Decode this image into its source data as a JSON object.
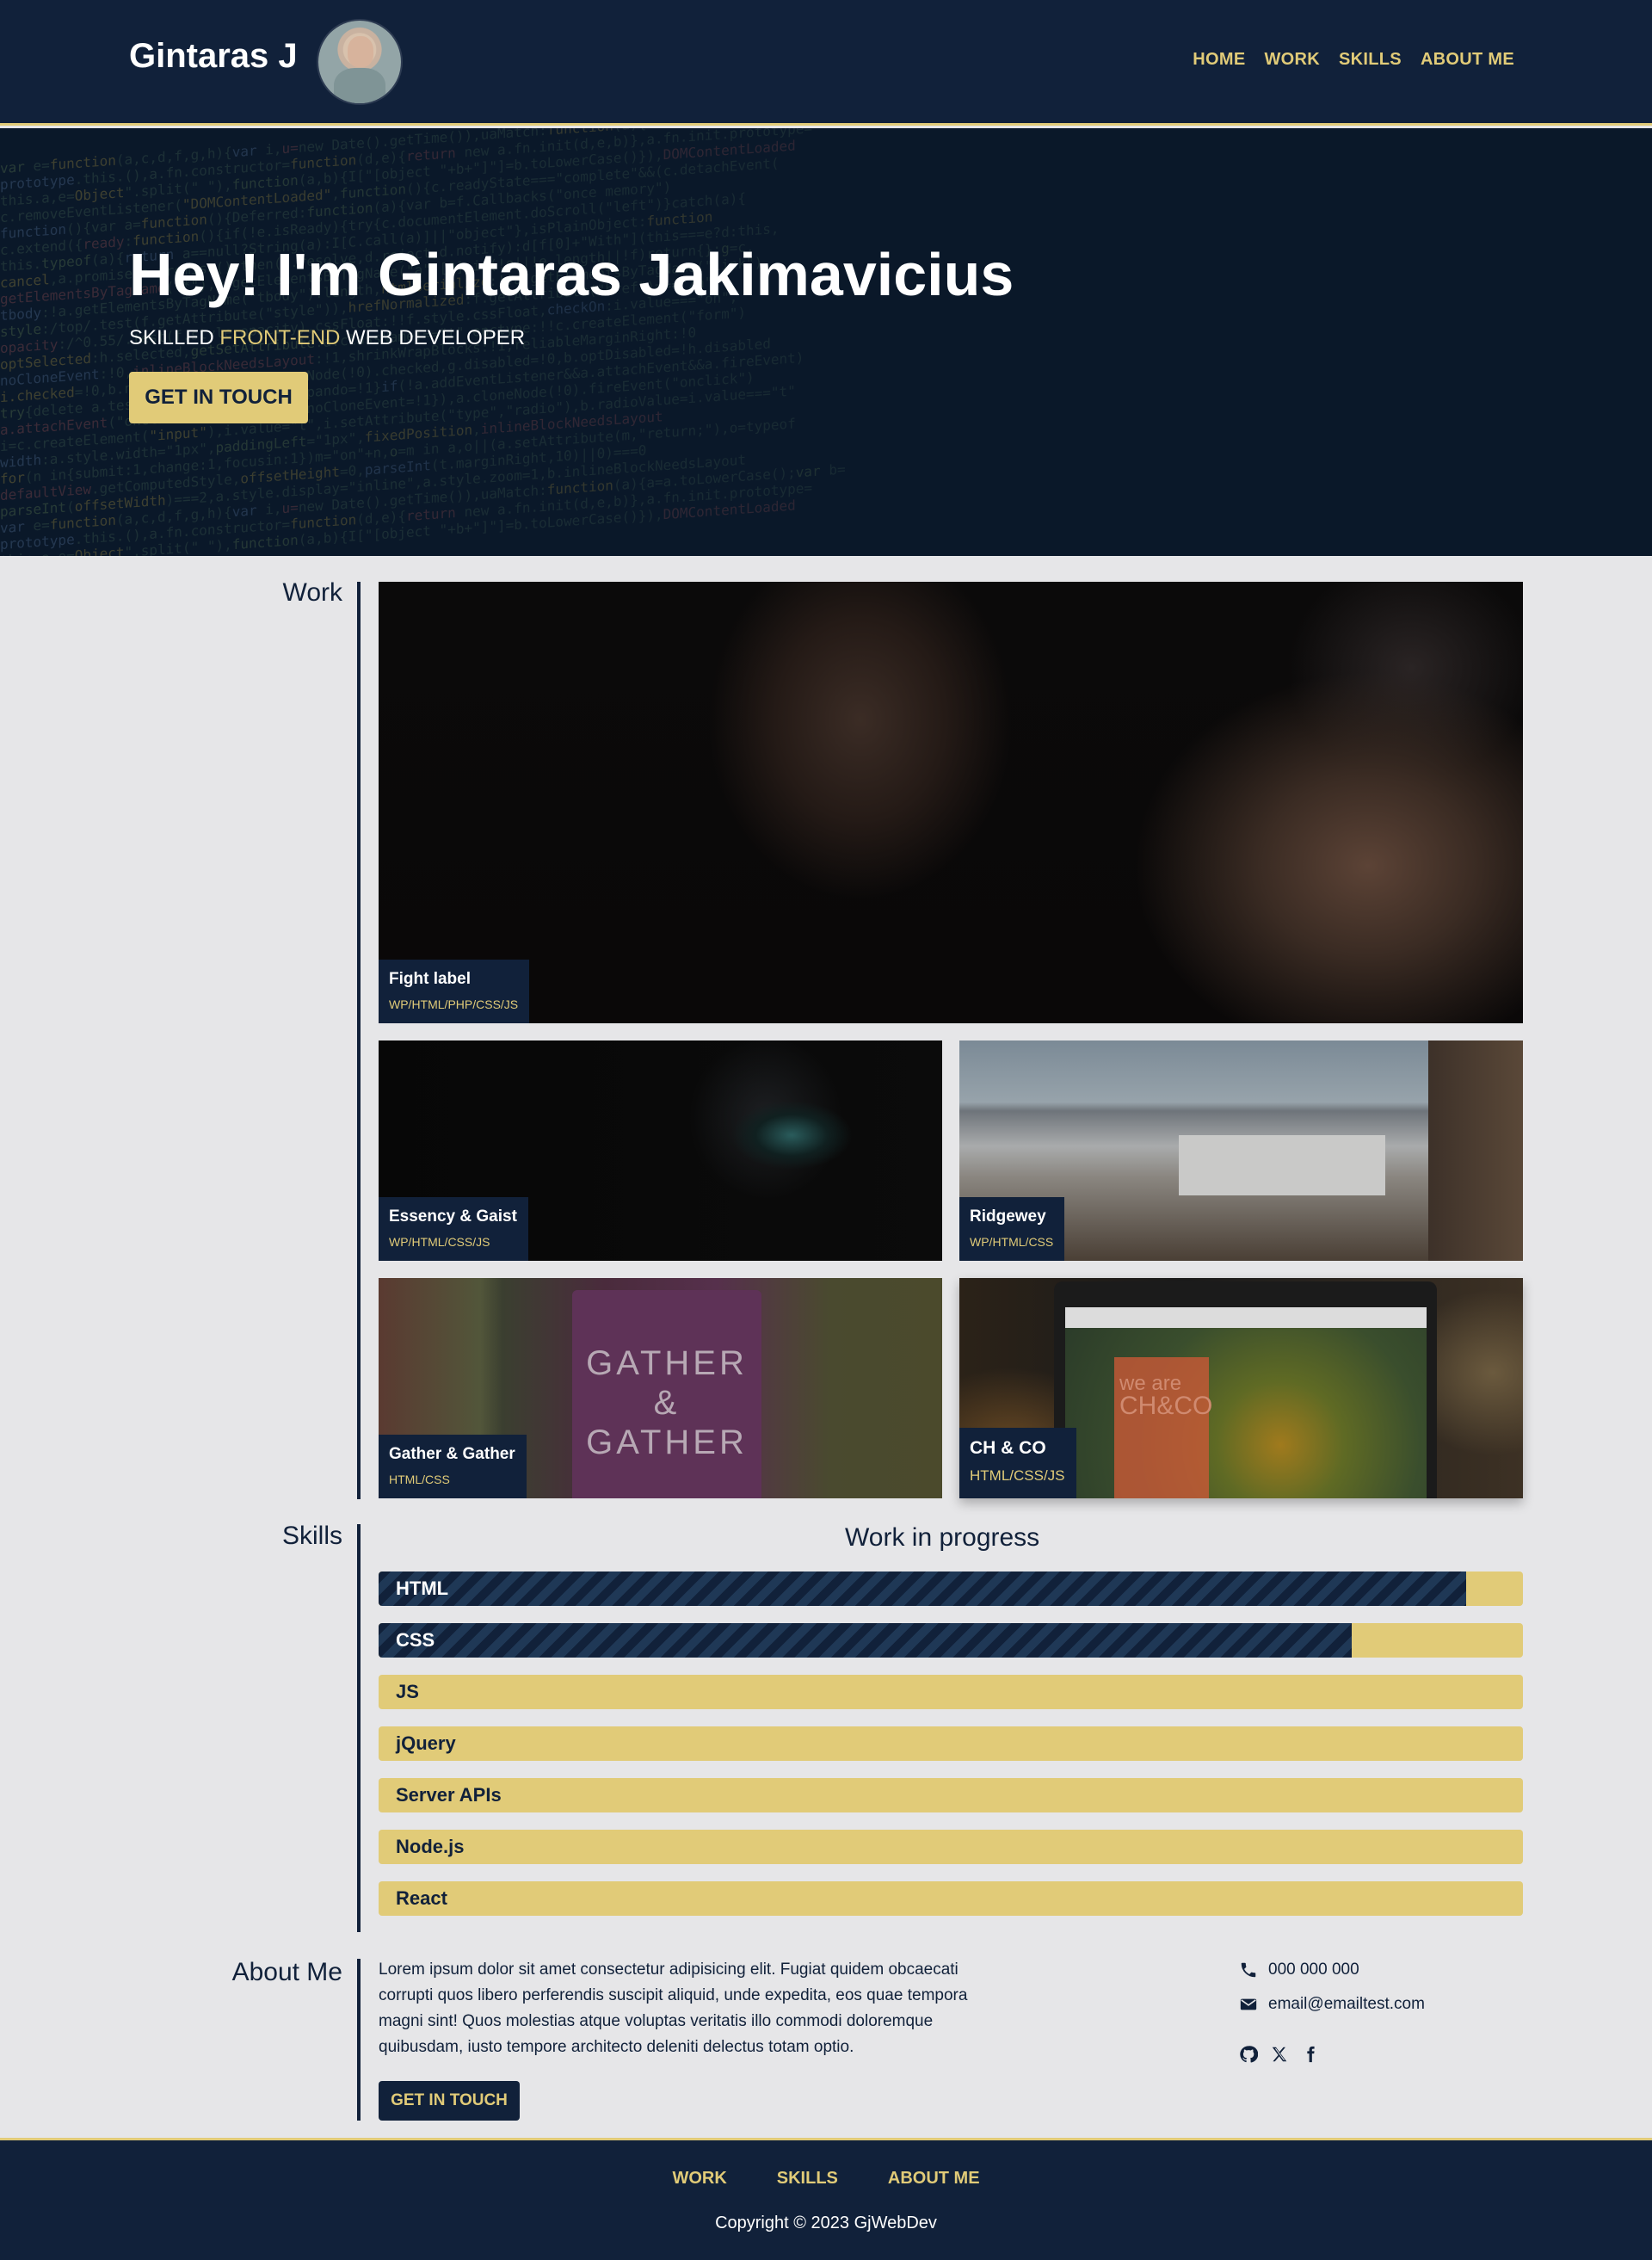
{
  "header": {
    "brand": "Gintaras J",
    "nav": [
      "HOME",
      "WORK",
      "SKILLS",
      "ABOUT ME"
    ]
  },
  "hero": {
    "title": "Hey! I'm Gintaras Jakimavicius",
    "subtitle_prefix": "SKILLED ",
    "subtitle_accent": "FRONT-END",
    "subtitle_suffix": " WEB DEVELOPER",
    "cta": "GET IN TOUCH"
  },
  "work": {
    "label": "Work",
    "projects": [
      {
        "title": "Fight label",
        "stack": "WP/HTML/PHP/CSS/JS"
      },
      {
        "title": "Essency & Gaist",
        "stack": "WP/HTML/CSS/JS"
      },
      {
        "title": "Ridgewey",
        "stack": "WP/HTML/CSS"
      },
      {
        "title": "Gather & Gather",
        "stack": "HTML/CSS"
      },
      {
        "title": "CH & CO",
        "stack": "HTML/CSS/JS"
      }
    ],
    "image_text": {
      "gather_line1": "GATHER",
      "gather_amp": "&",
      "gather_line2": "GATHER",
      "chco_line1": "we are",
      "chco_line2": "CH&CO"
    }
  },
  "skills": {
    "label": "Skills",
    "heading": "Work in progress",
    "items": [
      {
        "name": "HTML",
        "level": 0.95
      },
      {
        "name": "CSS",
        "level": 0.85
      },
      {
        "name": "JS",
        "level": 0
      },
      {
        "name": "jQuery",
        "level": 0
      },
      {
        "name": "Server APIs",
        "level": 0
      },
      {
        "name": "Node.js",
        "level": 0
      },
      {
        "name": "React",
        "level": 0
      }
    ]
  },
  "about": {
    "label": "About Me",
    "text": "Lorem ipsum dolor sit amet consectetur adipisicing elit. Fugiat quidem obcaecati corrupti quos libero perferendis suscipit aliquid, unde expedita, eos quae tempora magni sint! Quos molestias atque voluptas veritatis illo commodi doloremque quibusdam, iusto tempore architecto deleniti delectus totam optio.",
    "cta": "GET IN TOUCH",
    "phone": "000 000 000",
    "email": "email@emailtest.com",
    "socials": [
      "github-icon",
      "x-icon",
      "facebook-icon"
    ]
  },
  "footer": {
    "nav": [
      "WORK",
      "SKILLS",
      "ABOUT ME"
    ],
    "copyright": "Copyright © 2023 GjWebDev"
  },
  "colors": {
    "navy": "#11213a",
    "accent": "#e1cb78",
    "page_bg": "#e6e6e8"
  }
}
